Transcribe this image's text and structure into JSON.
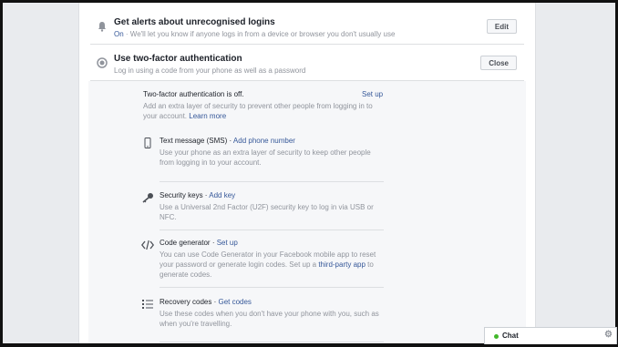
{
  "alerts": {
    "title": "Get alerts about unrecognised logins",
    "status": "On",
    "description": " · We'll let you know if anyone logs in from a device or browser you don't usually use",
    "button": "Edit"
  },
  "two_factor": {
    "title": "Use two-factor authentication",
    "description": "Log in using a code from your phone as well as a password",
    "button": "Close",
    "status_text": "Two-factor authentication is off.",
    "setup_link": "Set up",
    "intro": "Add an extra layer of security to prevent other people from logging in to your account. ",
    "learn_more": "Learn more"
  },
  "methods": [
    {
      "title": "Text message (SMS)",
      "action": "Add phone number",
      "description": "Use your phone as an extra layer of security to keep other people from logging in to your account.",
      "icon": "phone-icon"
    },
    {
      "title": "Security keys",
      "action": "Add key",
      "description": "Use a Universal 2nd Factor (U2F) security key to log in via USB or NFC.",
      "icon": "key-icon"
    },
    {
      "title": "Code generator",
      "action": "Set up",
      "description_before": "You can use Code Generator in your Facebook mobile app to reset your password or generate login codes. Set up a ",
      "description_link": "third-party app",
      "description_after": " to generate codes.",
      "icon": "code-icon"
    },
    {
      "title": "Recovery codes",
      "action": "Get codes",
      "description": "Use these codes when you don't have your phone with you, such as when you're travelling.",
      "icon": "list-icon"
    }
  ],
  "separator": " · ",
  "chat": {
    "label": "Chat",
    "status_color": "#42b72a"
  },
  "colors": {
    "link": "#365899",
    "muted": "#90949c",
    "background": "#e9ebee"
  }
}
